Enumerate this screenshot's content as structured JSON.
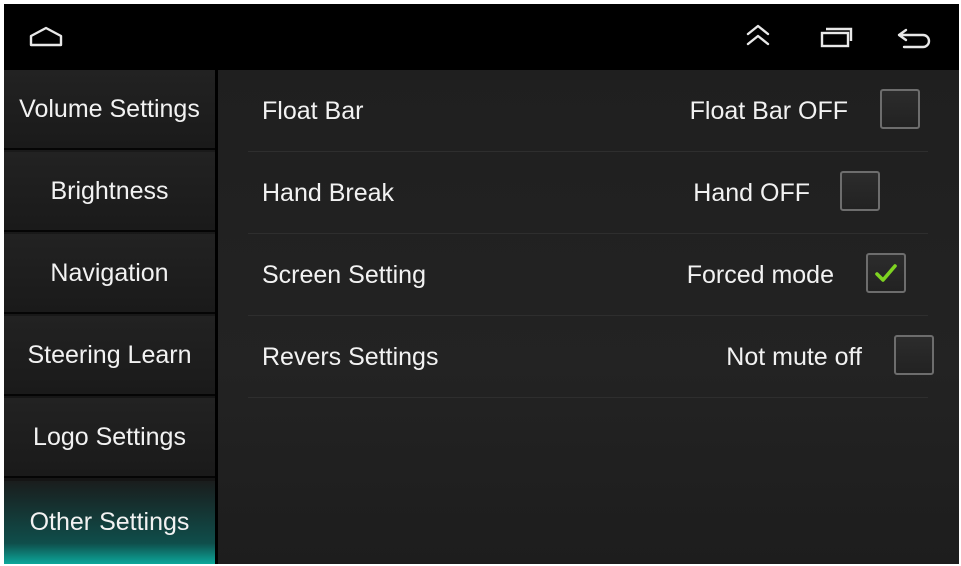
{
  "topbar": {
    "home_icon": "home-icon",
    "up_icon": "double-chevron-up-icon",
    "recents_icon": "recents-icon",
    "back_icon": "back-arrow-icon"
  },
  "sidebar": {
    "items": [
      {
        "label": "Volume Settings",
        "active": false
      },
      {
        "label": "Brightness",
        "active": false
      },
      {
        "label": "Navigation",
        "active": false
      },
      {
        "label": "Steering Learn",
        "active": false
      },
      {
        "label": "Logo Settings",
        "active": false
      },
      {
        "label": "Other Settings",
        "active": true
      }
    ]
  },
  "settings": [
    {
      "label": "Float Bar",
      "status": "Float Bar OFF",
      "checked": false
    },
    {
      "label": "Hand Break",
      "status": "Hand OFF",
      "checked": false
    },
    {
      "label": "Screen Setting",
      "status": "Forced mode",
      "checked": true
    },
    {
      "label": "Revers Settings",
      "status": "Not mute off",
      "checked": false
    }
  ],
  "colors": {
    "accent": "#0ca89b",
    "check": "#7ed321",
    "background": "#000000",
    "text": "#f2f2f2"
  }
}
